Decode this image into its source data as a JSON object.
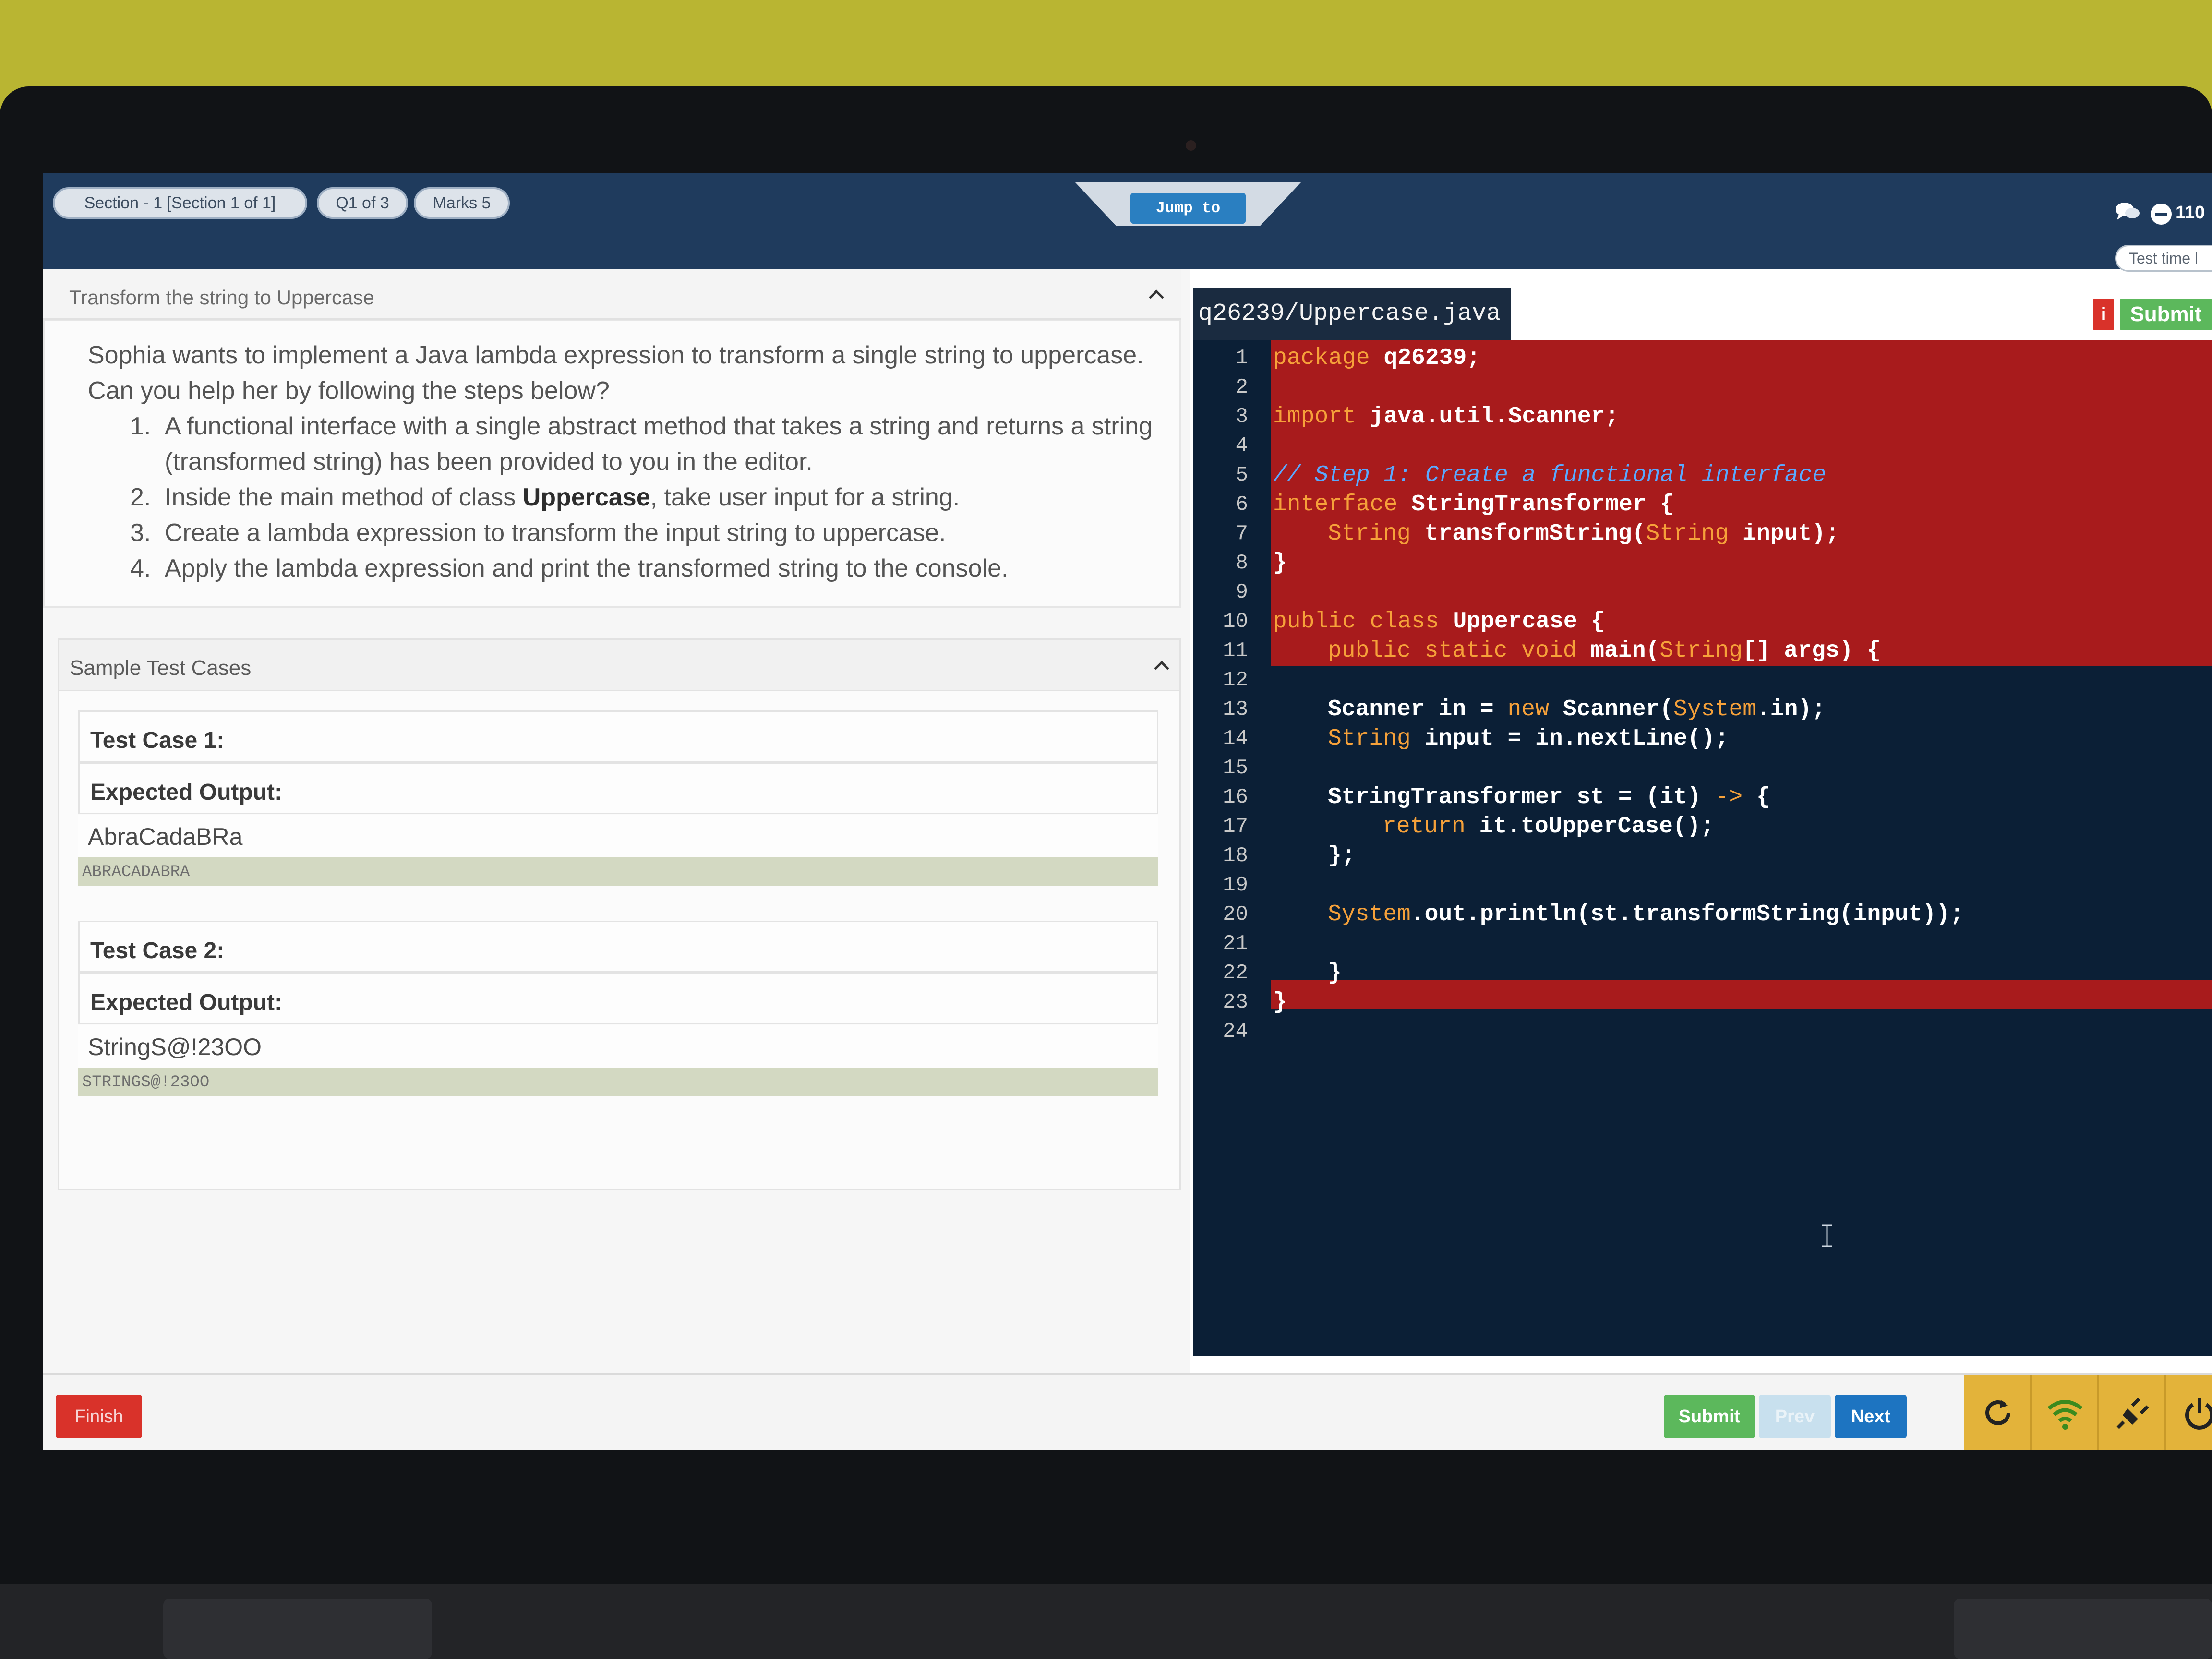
{
  "topbar": {
    "section_label": "Section - 1 [Section 1 of 1]",
    "question_label": "Q1 of 3",
    "marks_label": "Marks 5",
    "jump_label": "Jump to",
    "timer_text": "110",
    "test_time_label": "Test time l",
    "icons": [
      "chat-icon",
      "timer-icon"
    ]
  },
  "question": {
    "title": "Transform the string to Uppercase",
    "intro": "Sophia wants to implement a Java lambda expression to transform a single string to uppercase. Can you help her by following the steps below?",
    "steps": [
      {
        "num": "1.",
        "text": "A functional interface with a single abstract method that takes a string and returns a string (transformed string) has been provided to you in the editor."
      },
      {
        "num": "2.",
        "before": "Inside the main method of class ",
        "bold": "Uppercase",
        "after": ", take user input for a string."
      },
      {
        "num": "3.",
        "text": "Create a lambda expression to transform the input string to uppercase."
      },
      {
        "num": "4.",
        "text": "Apply the lambda expression and print the transformed string to the console."
      }
    ]
  },
  "tests": {
    "title": "Sample Test Cases",
    "expected_label": "Expected Output:",
    "cases": [
      {
        "label": "Test Case 1:",
        "input": "AbraCadaBRa",
        "output": "ABRACADABRA"
      },
      {
        "label": "Test Case 2:",
        "input": "StringS@!23OO",
        "output": "STRINGS@!23OO"
      }
    ]
  },
  "editor": {
    "filename": "q26239/Uppercase.java",
    "info_label": "i",
    "submit_label": "Submit",
    "line_numbers": [
      "1",
      "2",
      "3",
      "4",
      "5",
      "6",
      "7",
      "8",
      "9",
      "10",
      "11",
      "12",
      "13",
      "14",
      "15",
      "16",
      "17",
      "18",
      "19",
      "20",
      "21",
      "22",
      "23",
      "24"
    ],
    "code": {
      "l1_kw": "package",
      "l1_rest": " q26239;",
      "l3_kw": "import",
      "l3_rest": " java.util.Scanner;",
      "l5_cm": "// Step 1: Create a functional interface",
      "l6_kw": "interface",
      "l6_rest": " StringTransformer {",
      "l7_kw": "String",
      "l7_mid": " transformString(",
      "l7_kw2": "String",
      "l7_rest": " input);",
      "l8": "}",
      "l10_kw": "public class",
      "l10_rest": " Uppercase {",
      "l11_kw": "public static void",
      "l11_mid": " main(",
      "l11_kw2": "String",
      "l11_rest": "[] args) {",
      "l13_a": "Scanner in = ",
      "l13_kw": "new",
      "l13_b": " Scanner(",
      "l13_kw2": "System",
      "l13_c": ".in);",
      "l14_kw": "String",
      "l14_rest": " input = in.nextLine();",
      "l16_a": "StringTransformer st = (it) ",
      "l16_kw": "->",
      "l16_b": " {",
      "l17_kw": "return",
      "l17_rest": " it.toUpperCase();",
      "l18": "};",
      "l20_kw": "System",
      "l20_rest": ".out.println(st.transformString(input));",
      "l22": "}",
      "l23": "}"
    }
  },
  "footer": {
    "finish_label": "Finish",
    "submit_label": "Submit",
    "prev_label": "Prev",
    "next_label": "Next",
    "tools": [
      "refresh-icon",
      "wifi-icon",
      "plug-icon",
      "power-icon"
    ]
  },
  "colors": {
    "topbar": "#1f3b5d",
    "editor_bg": "#0b1f36",
    "highlight": "#a81b1c",
    "keyword": "#f6a13a",
    "comment": "#5aa9ff",
    "submit": "#5cb85c",
    "next": "#1d74c1",
    "finish": "#d9322a",
    "tool_bg": "#e3b33a"
  }
}
